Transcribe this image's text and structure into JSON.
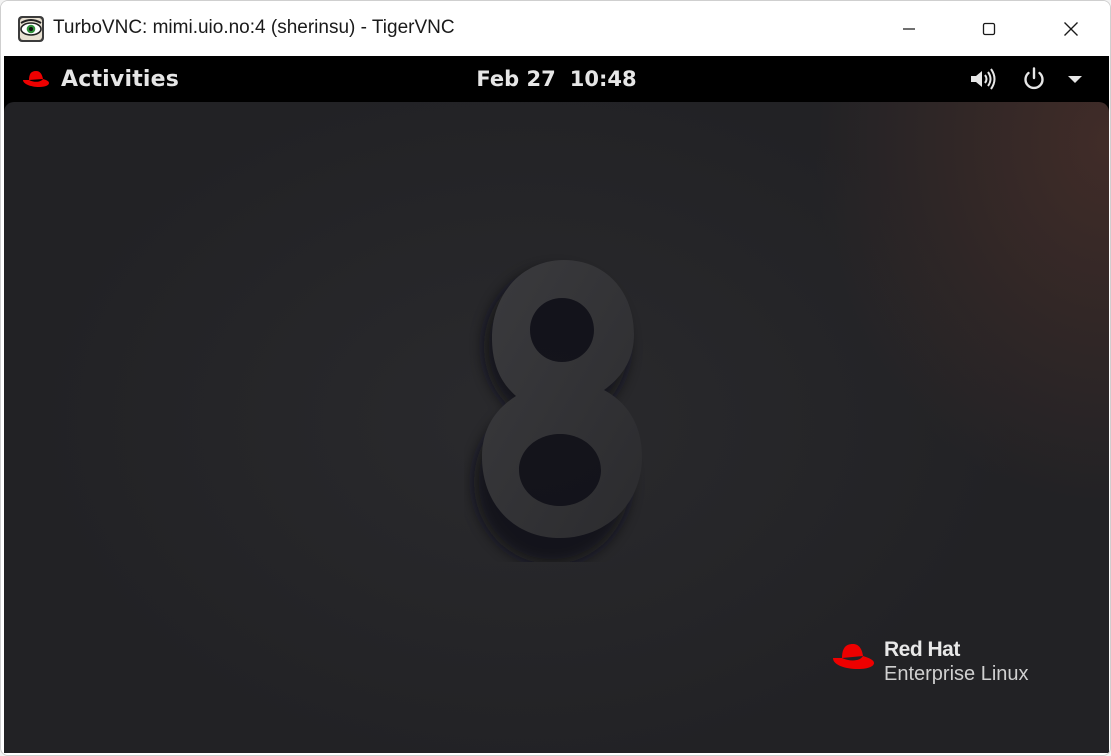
{
  "window": {
    "title": "TurboVNC: mimi.uio.no:4 (sherinsu) - TigerVNC",
    "icon": "tigervnc-eye-icon"
  },
  "topbar": {
    "activities_label": "Activities",
    "date": "Feb 27",
    "time": "10:48",
    "icons": [
      "volume-icon",
      "power-icon",
      "menu-arrow-icon"
    ]
  },
  "desktop": {
    "version_mark": "8",
    "brand_name": "Red Hat",
    "brand_product": "Enterprise Linux"
  },
  "colors": {
    "accent_red": "#ee0000",
    "topbar_bg": "#000000",
    "desktop_bg": "#232326"
  }
}
